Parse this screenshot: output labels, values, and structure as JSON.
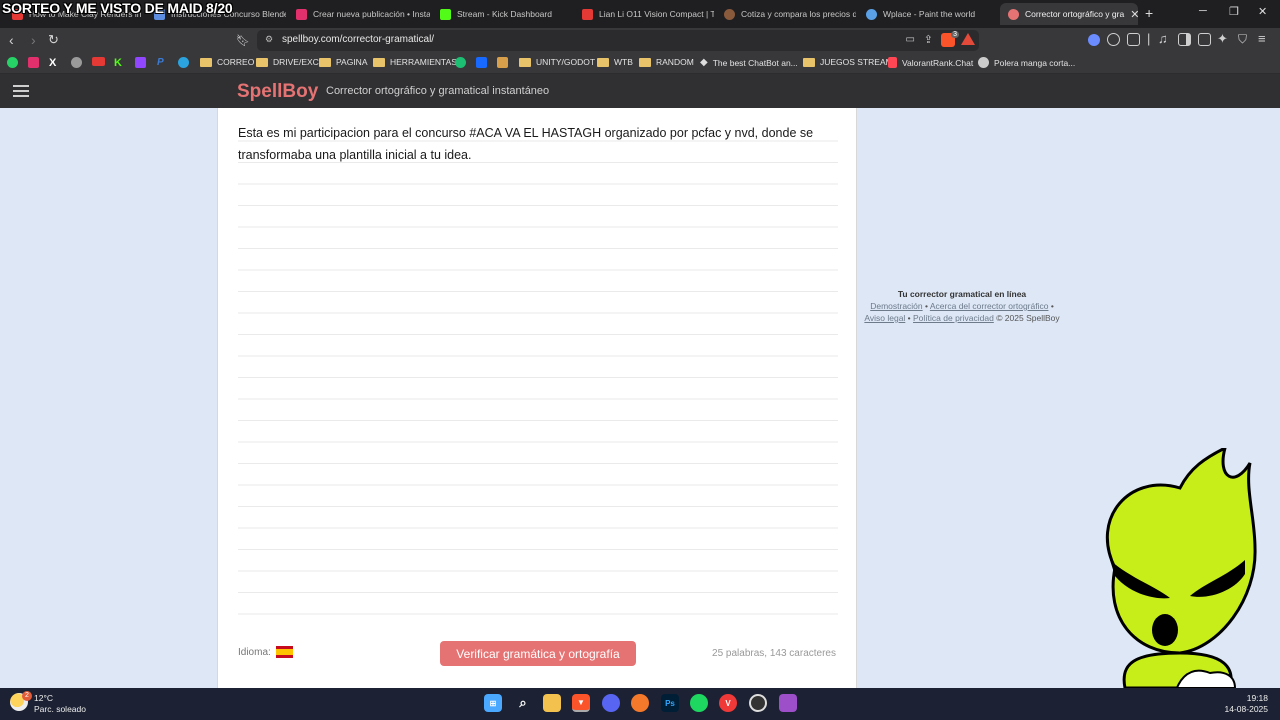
{
  "overlay_title": "SORTEO Y ME VISTO DE MAID 8/20",
  "tabs": [
    {
      "label": "How to Make Clay Renders in",
      "icon": "youtube-icon",
      "color": "#e53935",
      "active": false
    },
    {
      "label": "Instrucciones Concurso Blende",
      "icon": "docs-icon",
      "color": "#5c8de0",
      "active": false
    },
    {
      "label": "Crear nueva publicación • Insta",
      "icon": "instagram-icon",
      "color": "#e1306c",
      "active": false
    },
    {
      "label": "Stream - Kick Dashboard",
      "icon": "kick-icon",
      "color": "#53fc18",
      "active": false
    },
    {
      "label": "Lian Li O11 Vision Compact | Tl",
      "icon": "youtube-icon",
      "color": "#e53935",
      "active": false
    },
    {
      "label": "Cotiza y compara los precios d",
      "icon": "store-icon",
      "color": "#8a5a3c",
      "active": false
    },
    {
      "label": "Wplace - Paint the world",
      "icon": "globe-icon",
      "color": "#5aa0e6",
      "active": false
    },
    {
      "label": "Corrector ortográfico y gra",
      "icon": "spellboy-icon",
      "color": "#e57373",
      "active": true
    }
  ],
  "address": {
    "url": "spellboy.com/corrector-gramatical/",
    "brave_badge": "3"
  },
  "bookmarks": [
    {
      "label": "",
      "icon": "whatsapp-icon",
      "color": "#25d366"
    },
    {
      "label": "",
      "icon": "instagram-icon",
      "color": "#e1306c"
    },
    {
      "label": "",
      "icon": "x-icon",
      "color": "#ffffff"
    },
    {
      "label": "",
      "icon": "apple-icon",
      "color": "#9a9a9a"
    },
    {
      "label": "",
      "icon": "youtube-icon",
      "color": "#e53935"
    },
    {
      "label": "",
      "icon": "kick-icon",
      "color": "#53fc18"
    },
    {
      "label": "",
      "icon": "twitch-icon",
      "color": "#9146ff"
    },
    {
      "label": "",
      "icon": "paypal-icon",
      "color": "#3b7bd4"
    },
    {
      "label": "",
      "icon": "telegram-icon",
      "color": "#2aa3df"
    },
    {
      "label": "CORREO",
      "icon": "folder-icon",
      "color": "#e8c36a"
    },
    {
      "label": "DRIVE/EXC",
      "icon": "folder-icon",
      "color": "#e8c36a"
    },
    {
      "label": "PAGINA",
      "icon": "folder-icon",
      "color": "#e8c36a"
    },
    {
      "label": "HERRAMIENTAS",
      "icon": "folder-icon",
      "color": "#e8c36a"
    },
    {
      "label": "",
      "icon": "fiverr-icon",
      "color": "#1dbf73"
    },
    {
      "label": "",
      "icon": "behance-icon",
      "color": "#1769ff"
    },
    {
      "label": "",
      "icon": "bookmark-icon",
      "color": "#d8a04a"
    },
    {
      "label": "UNITY/GODOT",
      "icon": "folder-icon",
      "color": "#e8c36a"
    },
    {
      "label": "WTB",
      "icon": "folder-icon",
      "color": "#e8c36a"
    },
    {
      "label": "RANDOM",
      "icon": "folder-icon",
      "color": "#e8c36a"
    },
    {
      "label": "The best ChatBot an...",
      "icon": "chatbot-icon",
      "color": "#dddddd"
    },
    {
      "label": "JUEGOS STREAM",
      "icon": "folder-icon",
      "color": "#e8c36a"
    },
    {
      "label": "ValorantRank.Chat",
      "icon": "valorant-icon",
      "color": "#ff4655"
    },
    {
      "label": "Polera manga corta...",
      "icon": "globe-icon",
      "color": "#cccccc"
    }
  ],
  "site": {
    "logo": "SpellBoy",
    "tagline": "Corrector ortográfico y gramatical instantáneo"
  },
  "editor": {
    "text": "Esta es mi participacion para el concurso #ACA VA EL HASTAGH organizado por pcfac y nvd, donde se transformaba una plantilla inicial a tu idea.",
    "language_label": "Idioma:",
    "check_button": "Verificar gramática y ortografía",
    "counts": "25 palabras, 143 caracteres"
  },
  "sidebar": {
    "title": "Tu corrector gramatical en línea",
    "links": [
      "Demostración",
      "Acerca del corrector ortográfico",
      "Aviso legal",
      "Política de privacidad"
    ],
    "copyright": "© 2025 SpellBoy"
  },
  "taskbar": {
    "temperature": "12°C",
    "condition": "Parc. soleado",
    "weather_badge": "2",
    "time": "19:18",
    "date": "14-08-2025",
    "apps": [
      {
        "icon": "windows-start-icon",
        "color": "#4aa8ff"
      },
      {
        "icon": "search-icon",
        "color": "#ffffff"
      },
      {
        "icon": "file-explorer-icon",
        "color": "#f2c14e"
      },
      {
        "icon": "brave-icon",
        "color": "#fb542b"
      },
      {
        "icon": "discord-icon",
        "color": "#5865f2"
      },
      {
        "icon": "blender-icon",
        "color": "#f5792a"
      },
      {
        "icon": "photoshop-icon",
        "color": "#31a8ff"
      },
      {
        "icon": "spotify-icon",
        "color": "#1ed760"
      },
      {
        "icon": "vivaldi-icon",
        "color": "#ef3939"
      },
      {
        "icon": "obs-icon",
        "color": "#dddddd"
      },
      {
        "icon": "winrar-icon",
        "color": "#9c4fc9"
      }
    ]
  }
}
